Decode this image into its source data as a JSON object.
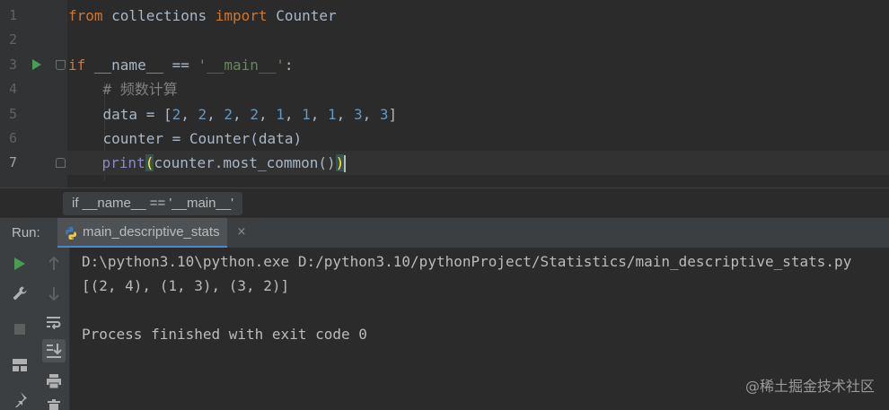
{
  "editor": {
    "line_numbers": [
      "1",
      "2",
      "3",
      "4",
      "5",
      "6",
      "7"
    ],
    "lines": [
      {
        "tokens": [
          {
            "t": "from",
            "c": "kw"
          },
          {
            "t": " collections ",
            "c": ""
          },
          {
            "t": "import",
            "c": "kw"
          },
          {
            "t": " Counter",
            "c": ""
          }
        ]
      },
      {
        "tokens": []
      },
      {
        "tokens": [
          {
            "t": "if",
            "c": "kw"
          },
          {
            "t": " __name__ == ",
            "c": ""
          },
          {
            "t": "'__main__'",
            "c": "str"
          },
          {
            "t": ":",
            "c": ""
          }
        ]
      },
      {
        "tokens": [
          {
            "t": "    # 频数计算",
            "c": "cmt"
          }
        ]
      },
      {
        "tokens": [
          {
            "t": "    data = [",
            "c": ""
          },
          {
            "t": "2",
            "c": "num"
          },
          {
            "t": ", ",
            "c": ""
          },
          {
            "t": "2",
            "c": "num"
          },
          {
            "t": ", ",
            "c": ""
          },
          {
            "t": "2",
            "c": "num"
          },
          {
            "t": ", ",
            "c": ""
          },
          {
            "t": "2",
            "c": "num"
          },
          {
            "t": ", ",
            "c": ""
          },
          {
            "t": "1",
            "c": "num"
          },
          {
            "t": ", ",
            "c": ""
          },
          {
            "t": "1",
            "c": "num"
          },
          {
            "t": ", ",
            "c": ""
          },
          {
            "t": "1",
            "c": "num"
          },
          {
            "t": ", ",
            "c": ""
          },
          {
            "t": "3",
            "c": "num"
          },
          {
            "t": ", ",
            "c": ""
          },
          {
            "t": "3",
            "c": "num"
          },
          {
            "t": "]",
            "c": ""
          }
        ]
      },
      {
        "tokens": [
          {
            "t": "    counter = Counter(data)",
            "c": ""
          }
        ]
      },
      {
        "tokens": [
          {
            "t": "    ",
            "c": ""
          },
          {
            "t": "print",
            "c": "bi"
          },
          {
            "t": "(",
            "c": "brace-hl"
          },
          {
            "t": "counter.most_common()",
            "c": ""
          },
          {
            "t": ")",
            "c": "brace-hl"
          }
        ]
      }
    ],
    "current_line": 7
  },
  "breadcrumb": {
    "text": "if __name__ == '__main__'"
  },
  "run": {
    "label": "Run:",
    "tab_title": "main_descriptive_stats",
    "tab_close": "×"
  },
  "console": {
    "lines": [
      "D:\\python3.10\\python.exe D:/python3.10/pythonProject/Statistics/main_descriptive_stats.py",
      "[(2, 4), (1, 3), (3, 2)]",
      "",
      "Process finished with exit code 0"
    ]
  },
  "watermark": {
    "text": "@稀土掘金技术社区"
  },
  "icons": {
    "run": "play-icon",
    "wrench": "wrench-icon",
    "stop": "stop-icon",
    "layout": "layout-icon",
    "pin": "pin-icon",
    "up": "arrow-up-icon",
    "down": "arrow-down-icon",
    "wrap": "soft-wrap-icon",
    "scroll": "scroll-to-end-icon",
    "print": "print-icon",
    "trash": "trash-icon"
  },
  "colors": {
    "run_green": "#499c54",
    "tab_underline": "#4a88c7",
    "keyword": "#cc7832",
    "string": "#6a8759",
    "number": "#6897bb"
  }
}
